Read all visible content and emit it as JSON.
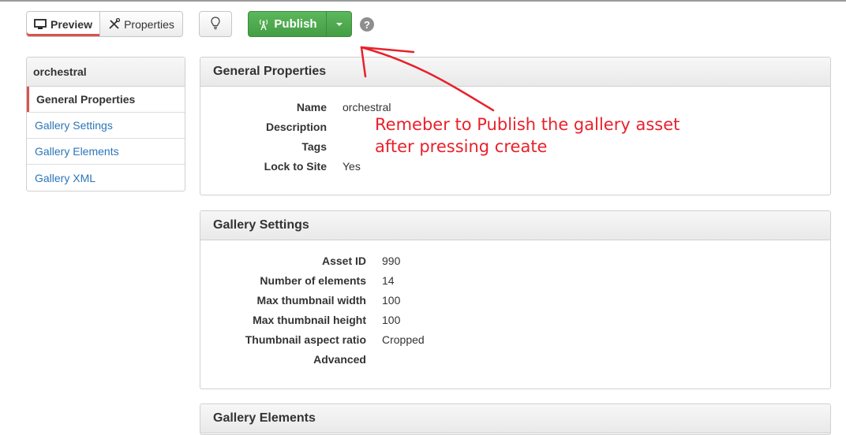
{
  "toolbar": {
    "preview_label": "Preview",
    "properties_label": "Properties",
    "publish_label": "Publish",
    "help_symbol": "?"
  },
  "sidebar": {
    "title": "orchestral",
    "items": [
      {
        "label": "General Properties",
        "active": true
      },
      {
        "label": "Gallery Settings"
      },
      {
        "label": "Gallery Elements"
      },
      {
        "label": "Gallery XML"
      }
    ]
  },
  "general_properties": {
    "title": "General Properties",
    "rows": [
      {
        "label": "Name",
        "value": "orchestral"
      },
      {
        "label": "Description",
        "value": ""
      },
      {
        "label": "Tags",
        "value": ""
      },
      {
        "label": "Lock to Site",
        "value": "Yes"
      }
    ]
  },
  "gallery_settings": {
    "title": "Gallery Settings",
    "rows": [
      {
        "label": "Asset ID",
        "value": "990"
      },
      {
        "label": "Number of elements",
        "value": "14"
      },
      {
        "label": "Max thumbnail width",
        "value": "100"
      },
      {
        "label": "Max thumbnail height",
        "value": "100"
      },
      {
        "label": "Thumbnail aspect ratio",
        "value": "Cropped"
      },
      {
        "label": "Advanced",
        "value": ""
      }
    ]
  },
  "gallery_elements": {
    "title": "Gallery Elements"
  },
  "annotation": {
    "line1": "Remeber to Publish the gallery asset",
    "line2": "after pressing create",
    "color": "#e8212b"
  }
}
